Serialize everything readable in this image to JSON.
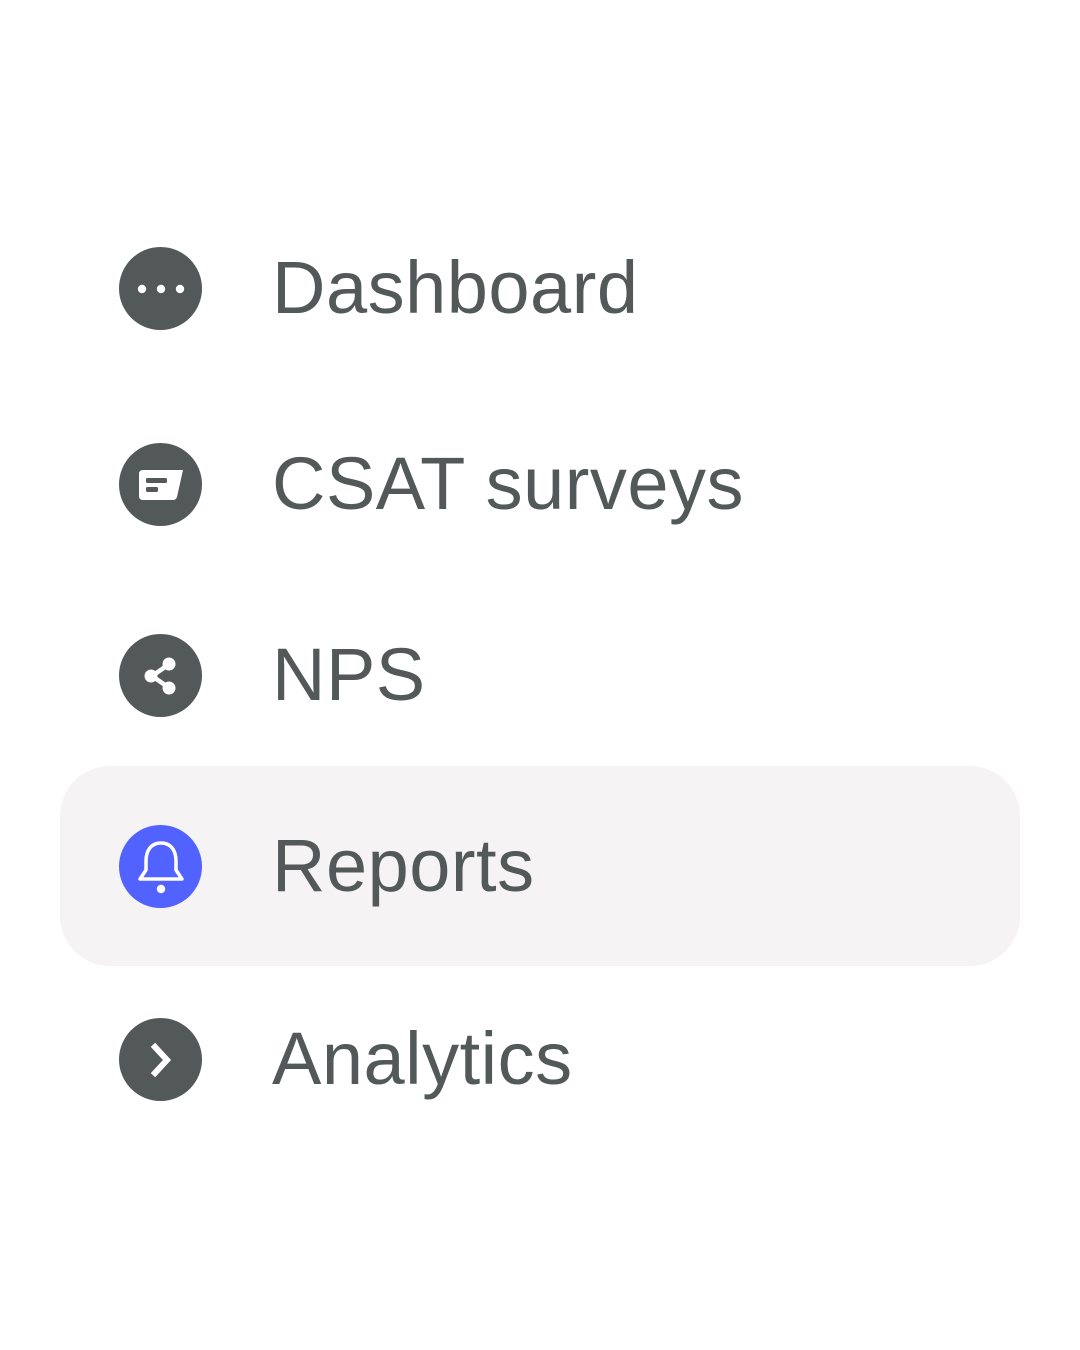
{
  "nav": {
    "active_index": 3,
    "accent_color": "#5162ff",
    "icon_color": "#535859",
    "text_color": "#535859",
    "active_background": "#f5f3f4",
    "items": [
      {
        "label": "Dashboard",
        "icon": "more-dots-icon",
        "active": false
      },
      {
        "label": "CSAT surveys",
        "icon": "message-card-icon",
        "active": false
      },
      {
        "label": "NPS",
        "icon": "share-icon",
        "active": false
      },
      {
        "label": "Reports",
        "icon": "bell-icon",
        "active": true
      },
      {
        "label": "Analytics",
        "icon": "chevron-right-icon",
        "active": false
      }
    ]
  }
}
